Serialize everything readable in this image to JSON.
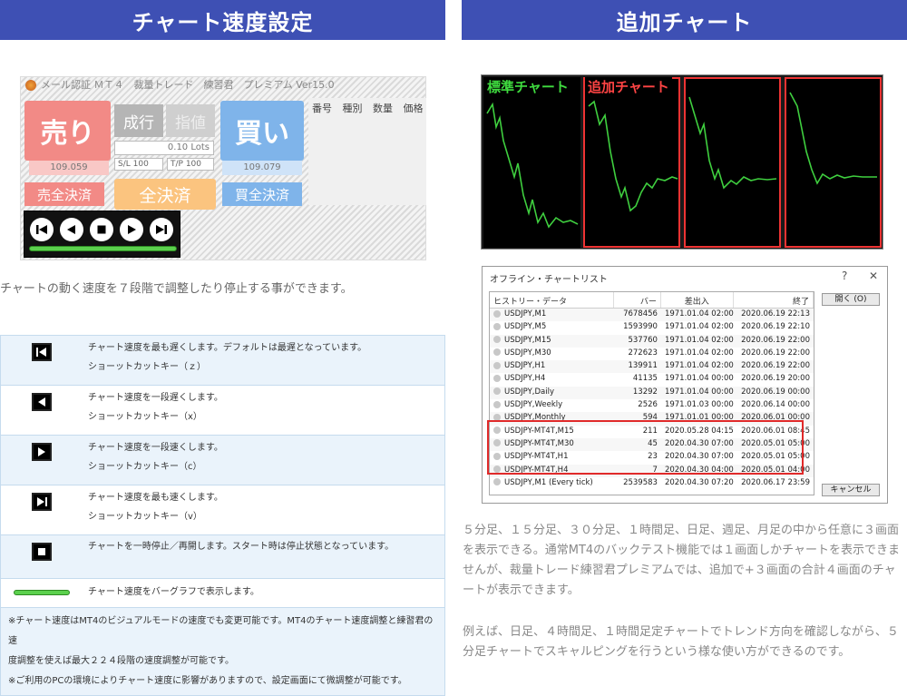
{
  "left_banner": "チャート速度設定",
  "right_banner": "追加チャート",
  "panel": {
    "title": "メール認証 ＭＴ４　裁量トレード　練習君　プレミアム Ver15.0",
    "sell_label": "売り",
    "sell_price": "109.059",
    "market_label": "成行",
    "limit_label": "指値",
    "lot_value": "0.10 Lots",
    "sl_value": "S/L  100",
    "tp_value": "T/P  100",
    "buy_label": "買い",
    "buy_price": "109.079",
    "sell_close": "売全決済",
    "all_close": "全決済",
    "buy_close": "買全決済",
    "orders_header": [
      "番号",
      "種別",
      "数量",
      "価格"
    ]
  },
  "speed_bar": {
    "buttons": [
      "first-icon",
      "prev-icon",
      "stop-icon",
      "next-icon",
      "last-icon"
    ]
  },
  "desc_speed": "チャートの動く速度を７段階で調整したり停止する事ができます。",
  "table": {
    "rows": [
      {
        "icon": "slowest-icon",
        "line1": "チャート速度を最も遅くします。デフォルトは最遅となっています。",
        "line2": "ショーットカットキー（ｚ）"
      },
      {
        "icon": "slower-icon",
        "line1": "チャート速度を一段遅くします。",
        "line2": "ショーットカットキー（x）"
      },
      {
        "icon": "faster-icon",
        "line1": "チャート速度を一段速くします。",
        "line2": "ショーットカットキー（c）"
      },
      {
        "icon": "fastest-icon",
        "line1": "チャート速度を最も速くします。",
        "line2": "ショーットカットキー（v）"
      },
      {
        "icon": "pause-icon",
        "line1": "チャートを一時停止／再開します。スタート時は停止状態となっています。",
        "line2": ""
      },
      {
        "icon": "bar-icon",
        "line1": "チャート速度をバーグラフで表示します。",
        "line2": ""
      }
    ],
    "note1": "※チャート速度はMT4のビジュアルモードの速度でも変更可能です。MT4のチャート速度調整と練習君の速",
    "note2": "度調整を使えば最大２２４段階の速度調整が可能です。",
    "note3": "※ご利用のPCの環境によりチャート速度に影響がありますので、設定画面にて微調整が可能です。"
  },
  "charts": {
    "label_standard": "標準チャート",
    "label_additional": "追加チャート"
  },
  "dialog": {
    "title": "オフライン・チャートリスト",
    "help": "?",
    "close": "✕",
    "columns": [
      "ヒストリー・データ",
      "バー",
      "差出入",
      "終了"
    ],
    "rows": [
      [
        "USDJPY,M1",
        "7678456",
        "1971.01.04 02:00",
        "2020.06.19 22:13"
      ],
      [
        "USDJPY,M5",
        "1593990",
        "1971.01.04 02:00",
        "2020.06.19 22:10"
      ],
      [
        "USDJPY,M15",
        "537760",
        "1971.01.04 02:00",
        "2020.06.19 22:00"
      ],
      [
        "USDJPY,M30",
        "272623",
        "1971.01.04 02:00",
        "2020.06.19 22:00"
      ],
      [
        "USDJPY,H1",
        "139911",
        "1971.01.04 02:00",
        "2020.06.19 22:00"
      ],
      [
        "USDJPY,H4",
        "41135",
        "1971.01.04 00:00",
        "2020.06.19 20:00"
      ],
      [
        "USDJPY,Daily",
        "13292",
        "1971.01.04 00:00",
        "2020.06.19 00:00"
      ],
      [
        "USDJPY,Weekly",
        "2526",
        "1971.01.03 00:00",
        "2020.06.14 00:00"
      ],
      [
        "USDJPY,Monthly",
        "594",
        "1971.01.01 00:00",
        "2020.06.01 00:00"
      ],
      [
        "USDJPY-MT4T,M15",
        "211",
        "2020.05.28 04:15",
        "2020.06.01 08:45"
      ],
      [
        "USDJPY-MT4T,M30",
        "45",
        "2020.04.30 07:00",
        "2020.05.01 05:00"
      ],
      [
        "USDJPY-MT4T,H1",
        "23",
        "2020.04.30 07:00",
        "2020.05.01 05:00"
      ],
      [
        "USDJPY-MT4T,H4",
        "7",
        "2020.04.30 04:00",
        "2020.05.01 04:00"
      ],
      [
        "USDJPY,M1 (Every tick)",
        "2539583",
        "2020.04.30 07:20",
        "2020.06.17 23:59"
      ]
    ],
    "open_button": "開く (O)",
    "cancel_button": "キャンセル"
  },
  "para1": "５分足、１５分足、３０分足、１時間足、日足、週足、月足の中から任意に３画面を表示できる。通常MT4のバックテスト機能では１画面しかチャートを表示できませんが、裁量トレード練習君プレミアムでは、追加で+３画面の合計４画面のチャートが表示できます。",
  "para2": "例えば、日足、４時間足、１時間足定チャートでトレンド方向を確認しながら、５分足チャートでスキャルピングを行うという様な使い方ができるのです。"
}
